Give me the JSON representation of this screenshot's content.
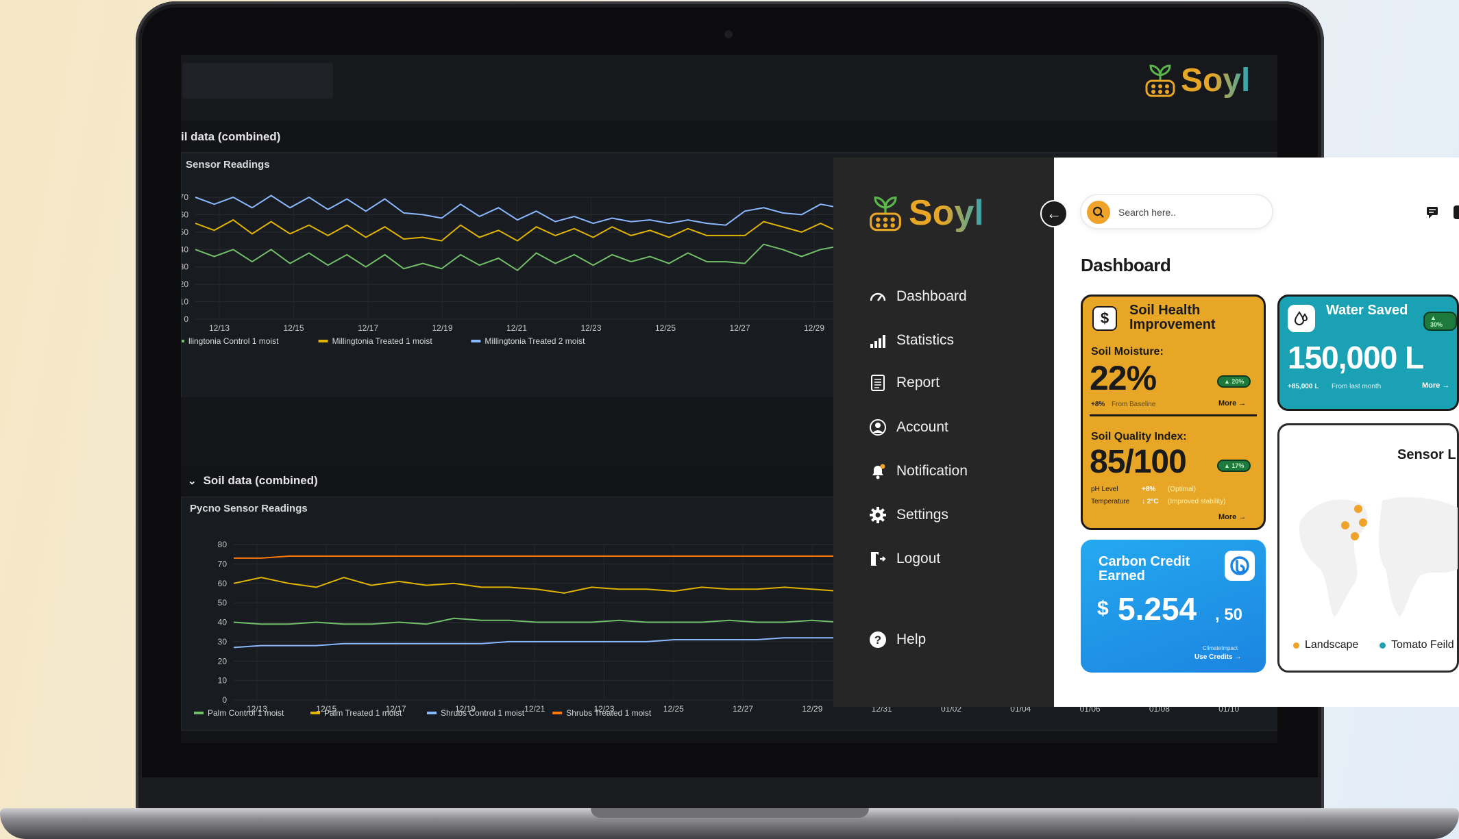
{
  "grafana": {
    "row_title_top": "il data (combined)",
    "panel1_title": "Sensor Readings",
    "row_title_bottom": "Soil data (combined)",
    "panel2_title": "Pycno Sensor Readings",
    "row_chevron": "⌄"
  },
  "brand": {
    "name": "Soyl",
    "icon": "sprout-sensor-icon"
  },
  "sidebar": {
    "items": [
      {
        "label": "Dashboard",
        "icon": "speedometer-icon"
      },
      {
        "label": "Statistics",
        "icon": "bar-signal-icon"
      },
      {
        "label": "Report",
        "icon": "document-icon"
      },
      {
        "label": "Account",
        "icon": "user-circle-icon"
      },
      {
        "label": "Notification",
        "icon": "bell-icon"
      },
      {
        "label": "Settings",
        "icon": "gear-icon"
      },
      {
        "label": "Logout",
        "icon": "logout-icon"
      },
      {
        "label": "Help",
        "icon": "help-icon"
      }
    ],
    "collapse_icon": "←"
  },
  "header": {
    "search_placeholder": "Search here..",
    "title": "Dashboard"
  },
  "cards": {
    "soil": {
      "currency_icon": "$",
      "title": "Soil Health Improvement",
      "moisture_label": "Soil Moisture:",
      "moisture_value": "22%",
      "moisture_badge": "▲ 20%",
      "moisture_delta": "+8%",
      "moisture_delta_text": "From Baseline",
      "more": "More",
      "quality_label": "Soil Quality Index:",
      "quality_value": "85/100",
      "quality_badge": "▲ 17%",
      "ph_label": "pH Level",
      "ph_delta": "+8%",
      "ph_note": "(Optimal)",
      "temp_label": "Temperature",
      "temp_delta": "↓ 2°C",
      "temp_note": "(Improved stability)"
    },
    "water": {
      "title": "Water Saved",
      "badge": "▲ 30%",
      "value": "150,000 L",
      "delta": "+85,000 L",
      "delta_text": "From last month",
      "more": "More"
    },
    "sensor": {
      "title": "Sensor L",
      "legend": [
        {
          "label": "Landscape",
          "color": "#f0a32a"
        },
        {
          "label": "Tomato Feild",
          "color": "#1aa2b4"
        }
      ]
    },
    "carbon": {
      "title": "Carbon Credit Earned",
      "currency": "$",
      "value": "5.254",
      "decimal": ", 50",
      "provider": "ClimateImpact",
      "link": "Use Credits"
    }
  },
  "chart_data": [
    {
      "type": "line",
      "title": "Sensor Readings",
      "x_ticks": [
        "12/13",
        "12/15",
        "12/17",
        "12/19",
        "12/21",
        "12/23",
        "12/25",
        "12/27",
        "12/29"
      ],
      "ylim": [
        0,
        70
      ],
      "y_ticks": [
        0,
        10,
        20,
        30,
        40,
        50,
        60,
        70
      ],
      "series": [
        {
          "name": "llingtonia Control 1 moist",
          "color": "#73bf69",
          "values": [
            40,
            36,
            40,
            33,
            40,
            32,
            38,
            31,
            37,
            30,
            37,
            29,
            32,
            29,
            37,
            31,
            35,
            28,
            38,
            32,
            37,
            31,
            37,
            33,
            36,
            32,
            38,
            33,
            33,
            32,
            43,
            40,
            36,
            40,
            42
          ]
        },
        {
          "name": "Millingtonia Treated 1 moist",
          "color": "#e0b400",
          "values": [
            55,
            51,
            57,
            49,
            56,
            49,
            54,
            48,
            54,
            47,
            53,
            46,
            47,
            45,
            54,
            47,
            51,
            45,
            53,
            48,
            52,
            47,
            53,
            48,
            51,
            47,
            52,
            48,
            48,
            48,
            56,
            53,
            50,
            55,
            50
          ]
        },
        {
          "name": "Millingtonia Treated 2 moist",
          "color": "#8ab8ff",
          "values": [
            70,
            66,
            70,
            64,
            71,
            64,
            70,
            63,
            69,
            62,
            69,
            61,
            60,
            58,
            66,
            59,
            64,
            57,
            62,
            56,
            59,
            55,
            58,
            56,
            57,
            55,
            57,
            55,
            54,
            62,
            64,
            61,
            60,
            66,
            64
          ]
        }
      ],
      "legend_position": "bottom-left",
      "grid": true
    },
    {
      "type": "line",
      "title": "Pycno Sensor Readings",
      "x_ticks": [
        "12/13",
        "12/15",
        "12/17",
        "12/19",
        "12/21",
        "12/23",
        "12/25",
        "12/27",
        "12/29",
        "12/31",
        "01/02",
        "01/04",
        "01/06",
        "01/08",
        "01/10"
      ],
      "ylim": [
        0,
        80
      ],
      "y_ticks": [
        0,
        10,
        20,
        30,
        40,
        50,
        60,
        70,
        80
      ],
      "series": [
        {
          "name": "Palm Control 1 moist",
          "color": "#73bf69",
          "values": [
            40,
            39,
            39,
            40,
            39,
            39,
            40,
            39,
            42,
            41,
            41,
            40,
            40,
            40,
            41,
            40,
            40,
            40,
            41,
            40,
            40,
            41,
            40
          ]
        },
        {
          "name": "Palm Treated 1 moist",
          "color": "#e0b400",
          "values": [
            60,
            63,
            60,
            58,
            63,
            59,
            61,
            59,
            60,
            58,
            58,
            57,
            55,
            58,
            57,
            57,
            56,
            58,
            57,
            57,
            58,
            57,
            56
          ]
        },
        {
          "name": "Shrubs Control 1 moist",
          "color": "#8ab8ff",
          "values": [
            27,
            28,
            28,
            28,
            29,
            29,
            29,
            29,
            29,
            29,
            30,
            30,
            30,
            30,
            30,
            30,
            31,
            31,
            31,
            31,
            32,
            32,
            32
          ]
        },
        {
          "name": "Shrubs Treated 1 moist",
          "color": "#ff780a",
          "values": [
            73,
            73,
            74,
            74,
            74,
            74,
            74,
            74,
            74,
            74,
            74,
            74,
            74,
            74,
            74,
            74,
            74,
            74,
            74,
            74,
            74,
            74,
            74
          ]
        }
      ],
      "legend_position": "bottom-left",
      "grid": true
    }
  ]
}
